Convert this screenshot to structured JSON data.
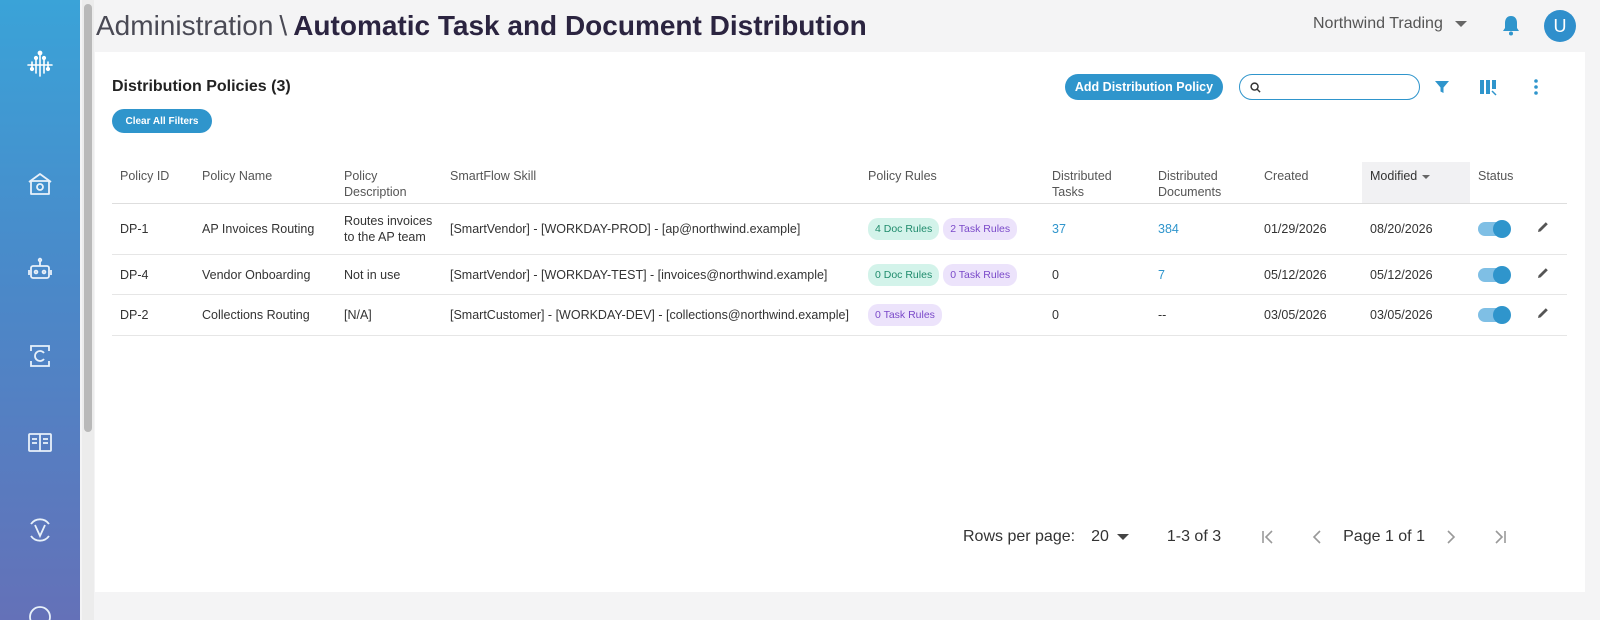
{
  "header": {
    "breadcrumb": "Administration",
    "separator": "\\",
    "page_title": "Automatic Task and Document Distribution",
    "org_name": "Northwind Trading",
    "avatar_initial": "U"
  },
  "sidebar": {
    "items": [
      {
        "icon": "logo-icon"
      },
      {
        "icon": "home-icon"
      },
      {
        "icon": "robot-icon"
      },
      {
        "icon": "cycle-c-icon"
      },
      {
        "icon": "book-icon"
      },
      {
        "icon": "cycle-v-icon"
      }
    ]
  },
  "panel": {
    "title": "Distribution Policies (3)",
    "clear_filters": "Clear All Filters",
    "add_button": "Add Distribution Policy",
    "search_value": ""
  },
  "table": {
    "columns": {
      "id": "Policy ID",
      "name": "Policy Name",
      "desc": "Policy Description",
      "skill": "SmartFlow Skill",
      "rules": "Policy Rules",
      "dtasks": "Distributed Tasks",
      "ddocs": "Distributed Documents",
      "created": "Created",
      "modified": "Modified",
      "status": "Status"
    },
    "rows": [
      {
        "id": "DP-1",
        "name": "AP Invoices Routing",
        "desc": "Routes invoices to the AP team",
        "skill": "[SmartVendor] - [WORKDAY-PROD] - [ap@northwind.example]",
        "doc_rules": "4 Doc Rules",
        "task_rules": "2 Task Rules",
        "dtasks": "37",
        "ddocs": "384",
        "created": "01/29/2026",
        "modified": "08/20/2026",
        "status_on": true
      },
      {
        "id": "DP-4",
        "name": "Vendor Onboarding",
        "desc": "Not in use",
        "skill": "[SmartVendor] - [WORKDAY-TEST] - [invoices@northwind.example]",
        "doc_rules": "0 Doc Rules",
        "task_rules": "0 Task Rules",
        "dtasks": "0",
        "ddocs": "7",
        "created": "05/12/2026",
        "modified": "05/12/2026",
        "status_on": true
      },
      {
        "id": "DP-2",
        "name": "Collections Routing",
        "desc": "[N/A]",
        "skill": "[SmartCustomer] - [WORKDAY-DEV] - [collections@northwind.example]",
        "task_rules": "0 Task Rules",
        "dtasks": "0",
        "ddocs": "--",
        "created": "03/05/2026",
        "modified": "03/05/2026",
        "status_on": true
      }
    ]
  },
  "pagination": {
    "rows_per_page_label": "Rows per page:",
    "rows_per_page": "20",
    "range": "1-3 of 3",
    "page_label": "Page 1 of 1"
  },
  "colors": {
    "accent": "#2f95cc",
    "sidebar_top": "#3aa3d8",
    "sidebar_bottom": "#6471b8",
    "doc_chip": "#d3f3ea",
    "task_chip": "#ece3fb"
  }
}
